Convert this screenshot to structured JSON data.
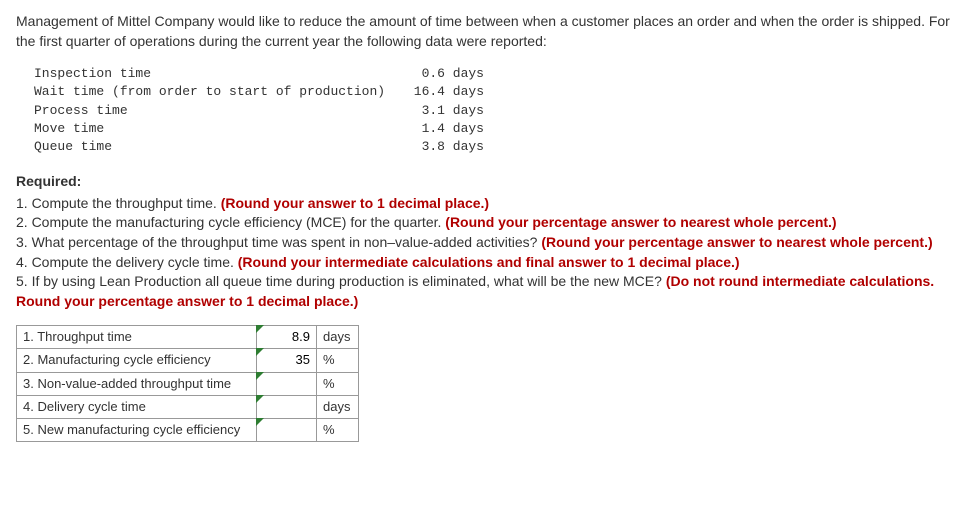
{
  "intro": "Management of Mittel Company would like to reduce the amount of time between when a customer places an order and when the order is shipped. For the first quarter of operations during the current year the following data were reported:",
  "reported_data": [
    {
      "label": "Inspection time",
      "value": "0.6 days"
    },
    {
      "label": "Wait time (from order to start of production)",
      "value": "16.4 days"
    },
    {
      "label": "Process time",
      "value": "3.1 days"
    },
    {
      "label": "Move time",
      "value": "1.4 days"
    },
    {
      "label": "Queue time",
      "value": "3.8 days"
    }
  ],
  "required_label": "Required:",
  "requirements": {
    "r1_text": "1. Compute the throughput time. ",
    "r1_bold": "(Round your answer to 1 decimal place.)",
    "r2_text": "2. Compute the manufacturing cycle efficiency (MCE) for the quarter. ",
    "r2_bold": "(Round your percentage answer to nearest whole percent.)",
    "r3_text": "3. What percentage of the throughput time was spent in non–value-added activities? ",
    "r3_bold": "(Round your percentage answer to nearest whole percent.)",
    "r4_text": "4. Compute the delivery cycle time. ",
    "r4_bold": "(Round your intermediate calculations and final answer to 1 decimal place.)",
    "r5_text": "5. If by using Lean Production all queue time during production is eliminated, what will be the new MCE? ",
    "r5_bold": "(Do not round intermediate calculations. Round your percentage answer to 1 decimal place.)"
  },
  "answers": [
    {
      "label": "1. Throughput time",
      "value": "8.9",
      "unit": "days"
    },
    {
      "label": "2. Manufacturing cycle efficiency",
      "value": "35",
      "unit": "%"
    },
    {
      "label": "3. Non-value-added throughput time",
      "value": "",
      "unit": "%"
    },
    {
      "label": "4. Delivery cycle time",
      "value": "",
      "unit": "days"
    },
    {
      "label": "5. New manufacturing cycle efficiency",
      "value": "",
      "unit": "%"
    }
  ]
}
